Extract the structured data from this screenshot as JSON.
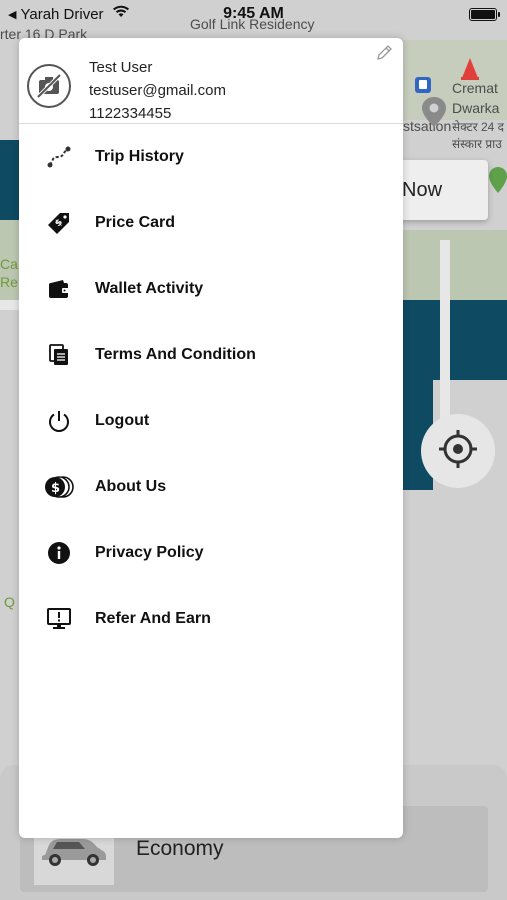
{
  "status_bar": {
    "back_app": "Yarah Driver",
    "time": "9:45 AM"
  },
  "map": {
    "labels": [
      "rter 16 D Park",
      "Golf Link Residency",
      "Cremat",
      "Dwarka",
      "stsation",
      "सेक्टर 24 द",
      "संस्कार प्राउ",
      "Ca",
      "Re",
      "Q"
    ]
  },
  "book_button": {
    "label": "Now"
  },
  "vehicle": {
    "name": "Economy"
  },
  "profile": {
    "name": "Test User",
    "email": "testuser@gmail.com",
    "phone": "1122334455"
  },
  "menu": {
    "items": [
      {
        "label": "Trip History",
        "icon": "route-icon"
      },
      {
        "label": "Price Card",
        "icon": "price-tag-icon"
      },
      {
        "label": "Wallet Activity",
        "icon": "wallet-icon"
      },
      {
        "label": "Terms And Condition",
        "icon": "documents-icon"
      },
      {
        "label": "Logout",
        "icon": "power-icon"
      },
      {
        "label": "About Us",
        "icon": "coins-icon"
      },
      {
        "label": "Privacy Policy",
        "icon": "info-icon"
      },
      {
        "label": "Refer And Earn",
        "icon": "monitor-alert-icon"
      }
    ]
  },
  "colors": {
    "water": "#0f4a63",
    "drawer_bg": "#ffffff",
    "text": "#111111"
  }
}
